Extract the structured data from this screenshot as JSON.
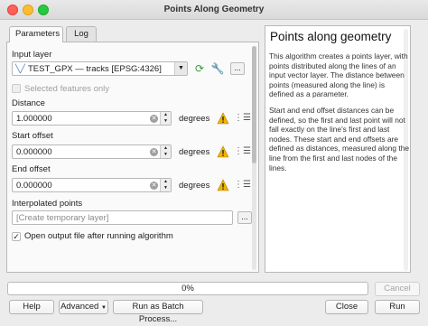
{
  "window": {
    "title": "Points Along Geometry"
  },
  "tabs": [
    {
      "label": "Parameters"
    },
    {
      "label": "Log"
    }
  ],
  "params": {
    "input_layer_label": "Input layer",
    "input_layer_value": "TEST_GPX — tracks [EPSG:4326]",
    "selected_only_label": "Selected features only",
    "distance_label": "Distance",
    "distance_value": "1.000000",
    "start_offset_label": "Start offset",
    "start_offset_value": "0.000000",
    "end_offset_label": "End offset",
    "end_offset_value": "0.000000",
    "unit": "degrees",
    "interpolated_label": "Interpolated points",
    "interpolated_placeholder": "[Create temporary layer]",
    "open_output_label": "Open output file after running algorithm",
    "more_button": "..."
  },
  "help": {
    "title": "Points along geometry",
    "para1": "This algorithm creates a points layer, with points distributed along the lines of an input vector layer. The distance between points (measured along the line) is defined as a parameter.",
    "para2": "Start and end offset distances can be defined, so the first and last point will not fall exactly on the line's first and last nodes. These start and end offsets are defined as distances, measured along the line from the first and last nodes of the lines."
  },
  "progress": {
    "text": "0%",
    "value": 0
  },
  "buttons": {
    "cancel": "Cancel",
    "help": "Help",
    "advanced": "Advanced",
    "batch": "Run as Batch Process...",
    "close": "Close",
    "run": "Run"
  },
  "colors": {
    "warning": "#f0b400",
    "sync_icon": "#3a9b3a",
    "progress_fill": "#5b9ad6"
  },
  "icons": {
    "vector_layer": "vector-line-icon",
    "iterate": "iterate-icon",
    "settings": "wrench-icon",
    "warning": "warning-icon",
    "data_defined": "data-defined-icon"
  }
}
